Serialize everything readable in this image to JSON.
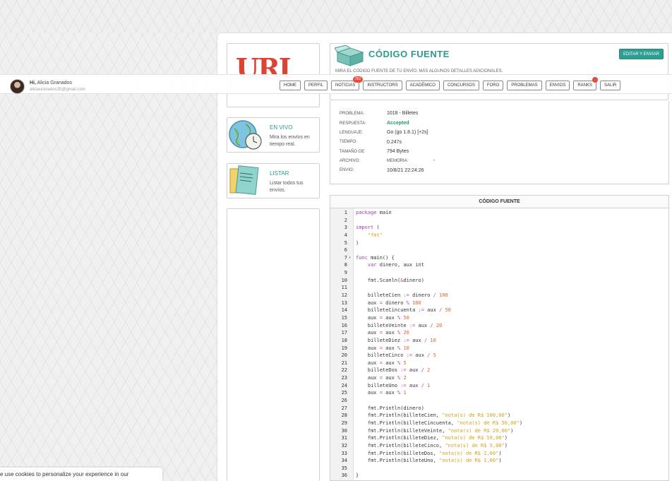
{
  "user": {
    "greeting": "Hi,",
    "name": "Alicia Granados",
    "email": "aliciaoranados35@gmail.com"
  },
  "nav": {
    "items": [
      {
        "label": "HOME"
      },
      {
        "label": "PERFIL"
      },
      {
        "label": "NOTICIAS",
        "badge": "352"
      },
      {
        "label": "INSTRUCTORS"
      },
      {
        "label": "ACADÉMICO"
      },
      {
        "label": "CONCURSOS"
      },
      {
        "label": "FORO"
      },
      {
        "label": "PROBLEMAS"
      },
      {
        "label": "ENVIOS"
      },
      {
        "label": "RANKS"
      },
      {
        "label": "SALIR"
      }
    ]
  },
  "sidebar": {
    "logo": "URI",
    "live": {
      "title": "EN VIVO",
      "text": "Mira los envíos en tiempo real."
    },
    "list": {
      "title": "LISTAR",
      "text": "Listar todos tus envíos."
    }
  },
  "header": {
    "title": "CÓDIGO FUENTE",
    "subtitle": "MIRA EL CÓDIGO FUENTE DE TU ENVÍO, MÁS ALGUNOS DETALLES ADICIONALES.",
    "submit_label": "EDITAR Y ENVIAR"
  },
  "info": {
    "problem_label": "PROBLEMA:",
    "problem_value": "1018 - Billetes",
    "answer_label": "RESPUESTA:",
    "answer_value": "Accepted",
    "language_label": "LENGUAJE:",
    "language_value": "Go (go 1.8.1) [+2s]",
    "time_label": "TIEMPO:",
    "time_value": "0.247s",
    "size_label": "TAMAÑO DE",
    "size_value": "794 Bytes",
    "file_label": "ARCHIVO:",
    "memory_label": "MEMORIA:",
    "memory_value": "-",
    "submission_label": "ENVIO:",
    "submission_value": "10/8/21 22:24:26"
  },
  "code": {
    "heading": "CÓDIGO FUENTE"
  },
  "cookie": {
    "text": "e use cookies to personalize your experience in our"
  },
  "colors": {
    "accent": "#2a9b8f",
    "badge": "#e94b3c",
    "accepted": "#1f9b67",
    "logo": "#d94435"
  }
}
